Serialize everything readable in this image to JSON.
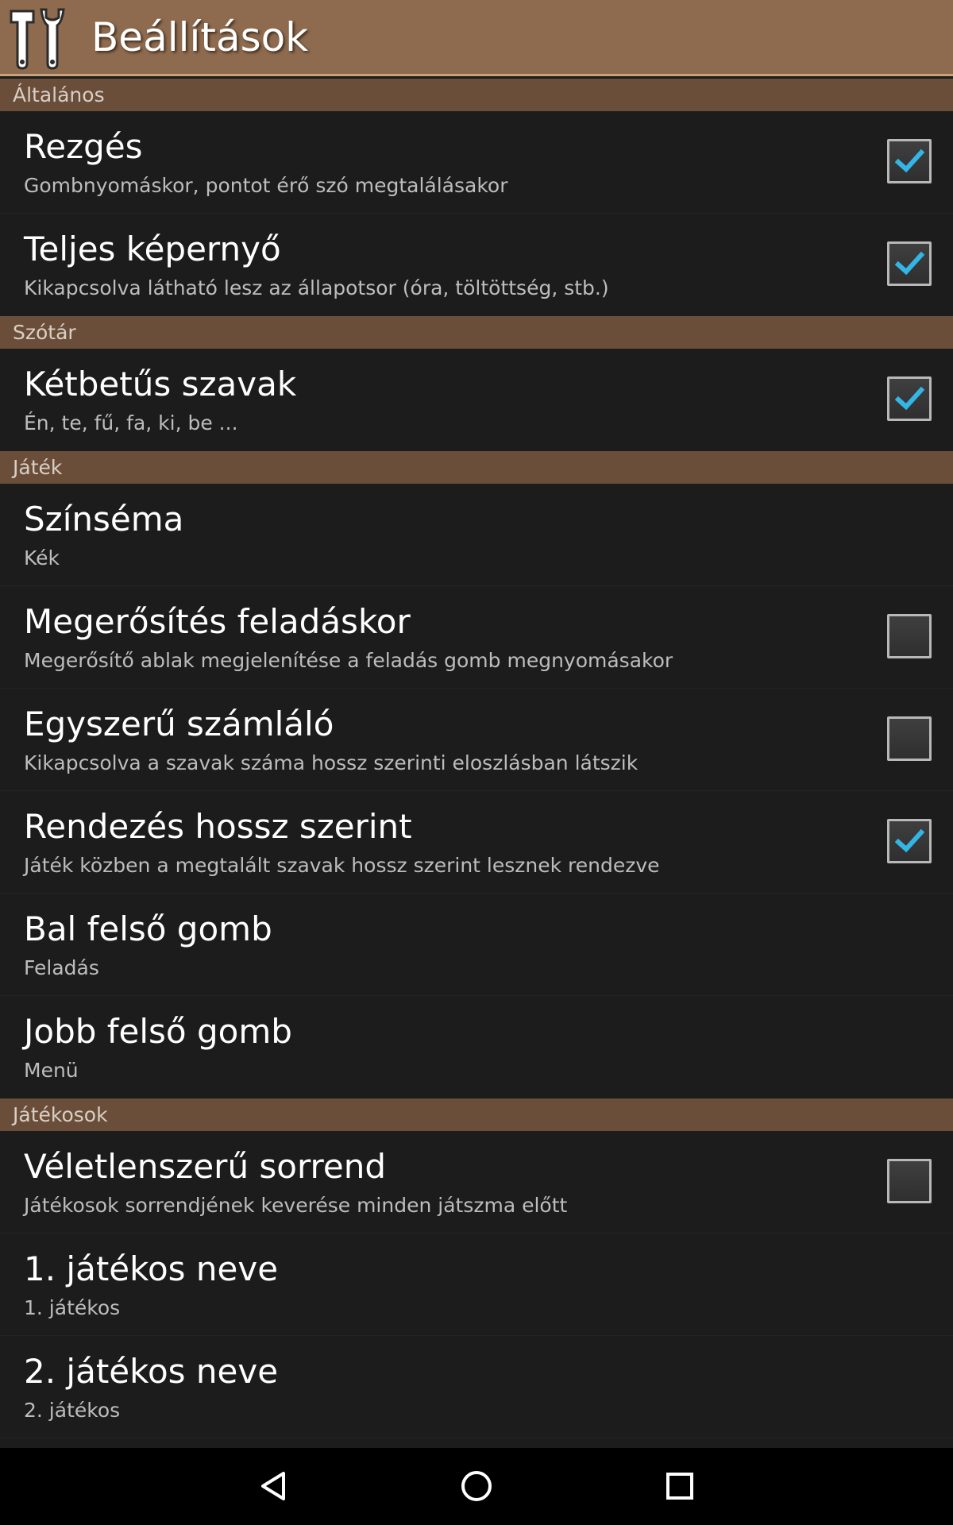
{
  "appbar": {
    "title": "Beállítások",
    "icon": "tools-icon"
  },
  "sections": [
    {
      "header": "Általános",
      "items": [
        {
          "title": "Rezgés",
          "summary": "Gombnyomáskor, pontot érő szó megtalálásakor",
          "checkbox": true,
          "checked": true
        },
        {
          "title": "Teljes képernyő",
          "summary": "Kikapcsolva látható lesz az állapotsor (óra, töltöttség, stb.)",
          "checkbox": true,
          "checked": true
        }
      ]
    },
    {
      "header": "Szótár",
      "items": [
        {
          "title": "Kétbetűs szavak",
          "summary": "Én, te, fű, fa, ki, be ...",
          "checkbox": true,
          "checked": true
        }
      ]
    },
    {
      "header": "Játék",
      "items": [
        {
          "title": "Színséma",
          "summary": "Kék",
          "checkbox": false
        },
        {
          "title": "Megerősítés feladáskor",
          "summary": "Megerősítő ablak megjelenítése a feladás gomb megnyomásakor",
          "checkbox": true,
          "checked": false
        },
        {
          "title": "Egyszerű számláló",
          "summary": "Kikapcsolva a szavak száma hossz szerinti eloszlásban látszik",
          "checkbox": true,
          "checked": false
        },
        {
          "title": "Rendezés hossz szerint",
          "summary": "Játék közben a megtalált szavak hossz szerint lesznek rendezve",
          "checkbox": true,
          "checked": true
        },
        {
          "title": "Bal felső gomb",
          "summary": "Feladás",
          "checkbox": false
        },
        {
          "title": "Jobb felső gomb",
          "summary": "Menü",
          "checkbox": false
        }
      ]
    },
    {
      "header": "Játékosok",
      "items": [
        {
          "title": "Véletlenszerű sorrend",
          "summary": "Játékosok sorrendjének keverése minden játszma előtt",
          "checkbox": true,
          "checked": false
        },
        {
          "title": "1. játékos neve",
          "summary": "1. játékos",
          "checkbox": false
        },
        {
          "title": "2. játékos neve",
          "summary": "2. játékos",
          "checkbox": false
        }
      ]
    }
  ],
  "navbar": {
    "back": "back-icon",
    "home": "home-icon",
    "recents": "recents-icon"
  },
  "colors": {
    "appbar": "#8e6b4f",
    "section_header": "#6a4e39",
    "background": "#1c1c1c",
    "check_accent": "#33b5e5"
  }
}
